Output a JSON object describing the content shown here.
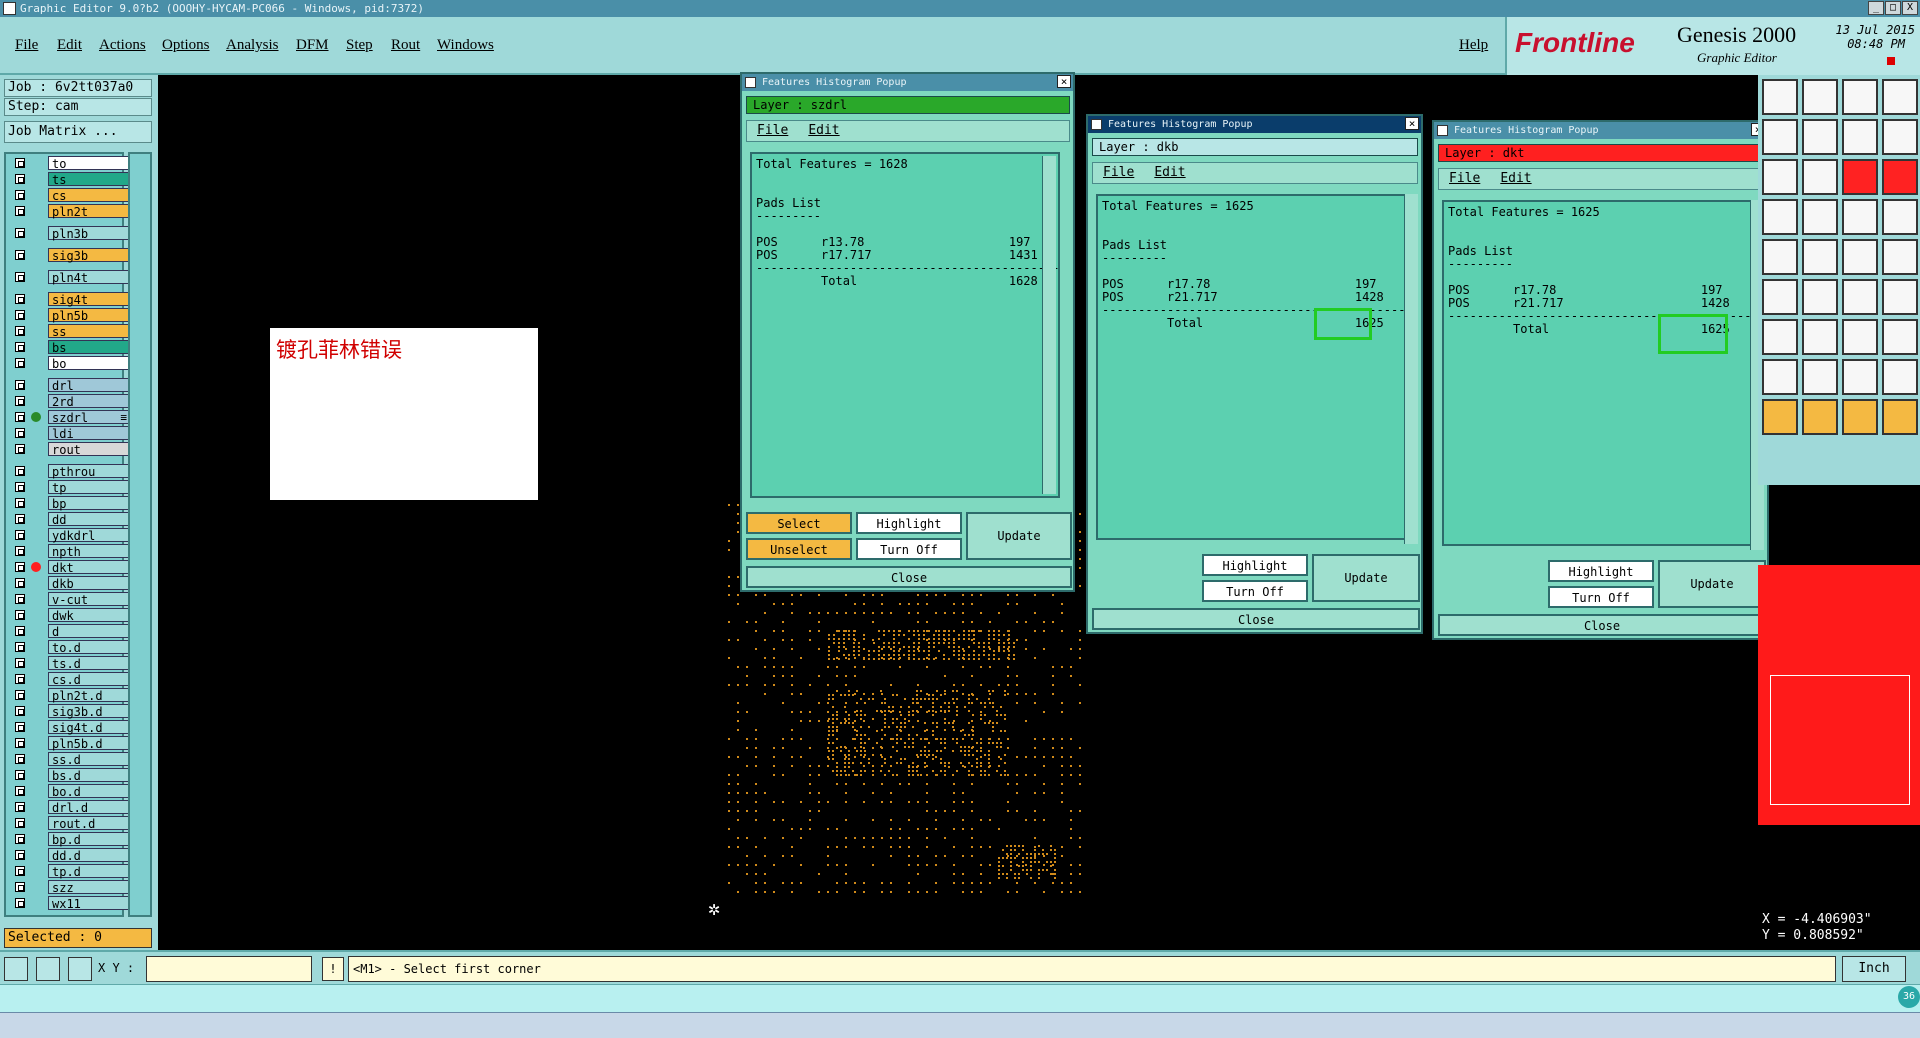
{
  "window": {
    "title": "Graphic Editor 9.0?b2 (OOOHY-HYCAM-PC066 - Windows, pid:7372)",
    "min": "_",
    "max": "□",
    "close": "X"
  },
  "menu": {
    "items": [
      "File",
      "Edit",
      "Actions",
      "Options",
      "Analysis",
      "DFM",
      "Step",
      "Rout",
      "Windows"
    ],
    "help": "Help"
  },
  "brand": {
    "logo": "Frontline",
    "product": "Genesis 2000",
    "subtitle": "Graphic Editor",
    "date": "13 Jul 2015",
    "time": "08:48 PM"
  },
  "left": {
    "job": "Job : 6v2tt037a0",
    "step": "Step: cam",
    "job_matrix": "Job Matrix ...",
    "selected": "Selected : 0",
    "layers": [
      {
        "name": "to",
        "color": "#ffffff",
        "ind": ""
      },
      {
        "name": "ts",
        "color": "#22a889",
        "ind": ""
      },
      {
        "name": "cs",
        "color": "#f4b942",
        "ind": ""
      },
      {
        "name": "pln2t",
        "color": "#f4b942",
        "ind": ""
      },
      {
        "name": "pln3b",
        "color": "#9fd9d9",
        "ind": ""
      },
      {
        "name": "sig3b",
        "color": "#f4b942",
        "ind": ""
      },
      {
        "name": "pln4t",
        "color": "#9fd9d9",
        "ind": ""
      },
      {
        "name": "sig4t",
        "color": "#f4b942",
        "ind": ""
      },
      {
        "name": "pln5b",
        "color": "#f4b942",
        "ind": ""
      },
      {
        "name": "ss",
        "color": "#f4b942",
        "ind": ""
      },
      {
        "name": "bs",
        "color": "#22a889",
        "ind": ""
      },
      {
        "name": "bo",
        "color": "#ffffff",
        "ind": ""
      },
      {
        "name": "drl",
        "color": "#9fc8d8",
        "ind": ""
      },
      {
        "name": "2rd",
        "color": "#9fc8d8",
        "ind": ""
      },
      {
        "name": "szdrl",
        "color": "#9fc8d8",
        "ind": "#2a8a2a",
        "marker": "≡"
      },
      {
        "name": "ldi",
        "color": "#9fc8d8",
        "ind": ""
      },
      {
        "name": "rout",
        "color": "#d8d8d8",
        "ind": ""
      },
      {
        "name": "pthrou",
        "color": "#9fd9d9",
        "ind": ""
      },
      {
        "name": "tp",
        "color": "#9fd9d9",
        "ind": ""
      },
      {
        "name": "bp",
        "color": "#9fd9d9",
        "ind": ""
      },
      {
        "name": "dd",
        "color": "#9fd9d9",
        "ind": ""
      },
      {
        "name": "ydkdrl",
        "color": "#9fd9d9",
        "ind": ""
      },
      {
        "name": "npth",
        "color": "#9fd9d9",
        "ind": ""
      },
      {
        "name": "dkt",
        "color": "#9fd9d9",
        "ind": "#ff2020"
      },
      {
        "name": "dkb",
        "color": "#9fd9d9",
        "ind": ""
      },
      {
        "name": "v-cut",
        "color": "#9fd9d9",
        "ind": ""
      },
      {
        "name": "dwk",
        "color": "#9fd9d9",
        "ind": ""
      },
      {
        "name": "d",
        "color": "#9fd9d9",
        "ind": ""
      },
      {
        "name": "to.d",
        "color": "#9fd9d9",
        "ind": ""
      },
      {
        "name": "ts.d",
        "color": "#9fd9d9",
        "ind": ""
      },
      {
        "name": "cs.d",
        "color": "#9fd9d9",
        "ind": ""
      },
      {
        "name": "pln2t.d",
        "color": "#9fd9d9",
        "ind": ""
      },
      {
        "name": "sig3b.d",
        "color": "#9fd9d9",
        "ind": ""
      },
      {
        "name": "sig4t.d",
        "color": "#9fd9d9",
        "ind": ""
      },
      {
        "name": "pln5b.d",
        "color": "#9fd9d9",
        "ind": ""
      },
      {
        "name": "ss.d",
        "color": "#9fd9d9",
        "ind": ""
      },
      {
        "name": "bs.d",
        "color": "#9fd9d9",
        "ind": ""
      },
      {
        "name": "bo.d",
        "color": "#9fd9d9",
        "ind": ""
      },
      {
        "name": "drl.d",
        "color": "#9fd9d9",
        "ind": ""
      },
      {
        "name": "rout.d",
        "color": "#9fd9d9",
        "ind": ""
      },
      {
        "name": "bp.d",
        "color": "#9fd9d9",
        "ind": ""
      },
      {
        "name": "dd.d",
        "color": "#9fd9d9",
        "ind": ""
      },
      {
        "name": "tp.d",
        "color": "#9fd9d9",
        "ind": ""
      },
      {
        "name": "szz",
        "color": "#9fd9d9",
        "ind": ""
      },
      {
        "name": "wx11",
        "color": "#9fd9d9",
        "ind": ""
      }
    ]
  },
  "note": {
    "text": "镀孔菲林错误"
  },
  "popups": [
    {
      "title": "Features Histogram Popup",
      "layer": "Layer : szdrl",
      "layer_color": "#2aa82a",
      "file": "File",
      "edit": "Edit",
      "body": "Total Features = 1628\n\n\nPads List\n---------\n\nPOS      r13.78                    197\nPOS      r17.717                   1431\n------------------------------------------\n         Total                     1628",
      "buttons": {
        "select": "Select",
        "unselect": "Unselect",
        "highlight": "Highlight",
        "turnoff": "Turn Off",
        "update": "Update",
        "close": "Close"
      }
    },
    {
      "title": "Features Histogram Popup",
      "layer": "Layer : dkb",
      "layer_color": "#b8e6e6",
      "file": "File",
      "edit": "Edit",
      "body": "Total Features = 1625\n\n\nPads List\n---------\n\nPOS      r17.78                    197\nPOS      r21.717                   1428\n------------------------------------------\n         Total                     1625",
      "total_value": "1625",
      "buttons": {
        "highlight": "Highlight",
        "turnoff": "Turn Off",
        "update": "Update",
        "close": "Close"
      }
    },
    {
      "title": "Features Histogram Popup",
      "layer": "Layer : dkt",
      "layer_color": "#ff2020",
      "file": "File",
      "edit": "Edit",
      "body": "Total Features = 1625\n\n\nPads List\n---------\n\nPOS      r17.78                    197\nPOS      r21.717                   1428\n------------------------------------------\n         Total                     1625",
      "total_value": "1625",
      "buttons": {
        "highlight": "Highlight",
        "turnoff": "Turn Off",
        "update": "Update",
        "close": "Close"
      }
    }
  ],
  "coords": {
    "x": "X = -4.406903\"",
    "y": "Y = 0.808592\""
  },
  "status": {
    "xy_label": "X Y :",
    "xy_value": "",
    "message": "<M1> - Select first corner",
    "units": "Inch",
    "counter": "36"
  }
}
